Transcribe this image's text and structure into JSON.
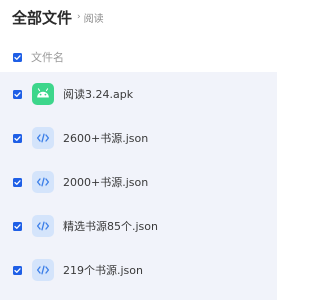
{
  "header": {
    "title": "全部文件",
    "separator": "›",
    "breadcrumb": "阅读"
  },
  "list_header": {
    "column_label": "文件名",
    "select_all_checked": true
  },
  "files": [
    {
      "name": "阅读3.24.apk",
      "icon": "android-icon",
      "checked": true
    },
    {
      "name": "2600+书源.json",
      "icon": "code-file-icon",
      "checked": true
    },
    {
      "name": "2000+书源.json",
      "icon": "code-file-icon",
      "checked": true
    },
    {
      "name": "精选书源85个.json",
      "icon": "code-file-icon",
      "checked": true
    },
    {
      "name": "219个书源.json",
      "icon": "code-file-icon",
      "checked": true
    }
  ],
  "colors": {
    "accent": "#1f5fe6",
    "list_background": "#f1f3fa",
    "apk_icon_bg": "#3dd68b",
    "json_icon_bg": "#d4e4fb",
    "json_icon_fg": "#3b7ee8"
  }
}
